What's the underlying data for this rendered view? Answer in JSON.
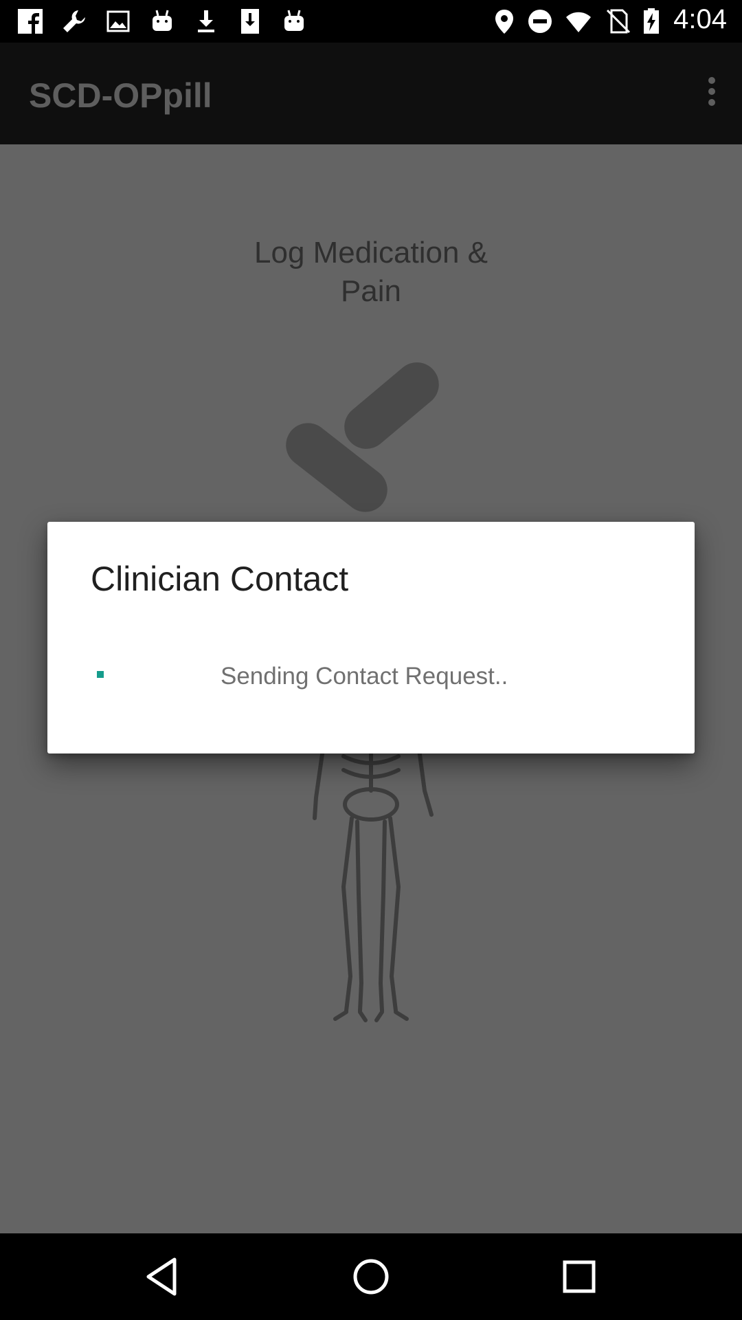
{
  "status_bar": {
    "time": "4:04",
    "icons": [
      "facebook-icon",
      "wrench-icon",
      "image-icon",
      "android-icon",
      "download-icon",
      "download-file-icon",
      "android-icon",
      "location-icon",
      "do-not-disturb-icon",
      "wifi-icon",
      "no-sim-icon",
      "battery-charging-icon"
    ]
  },
  "app_bar": {
    "title": "SCD-OPpill",
    "overflow_icon": "more-vert-icon"
  },
  "main": {
    "log_label_line1": "Log Medication &",
    "log_label_line2": "Pain",
    "pills_icon": "pills-icon",
    "skeleton_icon": "skeleton-icon"
  },
  "dialog": {
    "title": "Clinician Contact",
    "message": "Sending Contact Request..",
    "spinner_color": "#159c8c"
  },
  "nav_bar": {
    "icons": [
      "back-icon",
      "home-icon",
      "recents-icon"
    ]
  },
  "colors": {
    "scrim": "#646464",
    "app_bar": "#0f0f0f",
    "dialog_bg": "#ffffff",
    "accent": "#159c8c"
  }
}
